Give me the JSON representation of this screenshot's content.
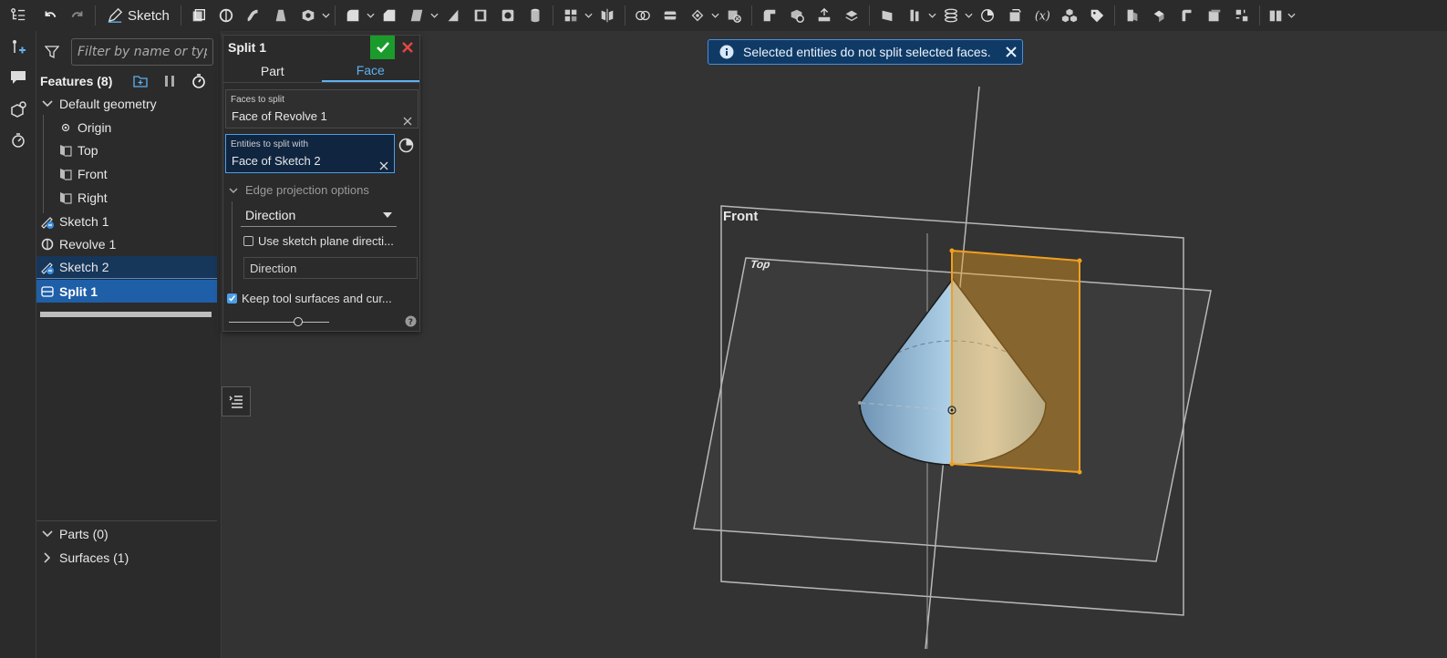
{
  "toolbar": {
    "sketch_label": "Sketch"
  },
  "feature_panel": {
    "filter_placeholder": "Filter by name or type",
    "features_title": "Features (8)",
    "tree": [
      {
        "label": "Default geometry"
      },
      {
        "label": "Origin"
      },
      {
        "label": "Top"
      },
      {
        "label": "Front"
      },
      {
        "label": "Right"
      },
      {
        "label": "Sketch 1"
      },
      {
        "label": "Revolve 1"
      },
      {
        "label": "Sketch 2"
      },
      {
        "label": "Split 1"
      }
    ],
    "parts_label": "Parts (0)",
    "surfaces_label": "Surfaces (1)"
  },
  "split_dialog": {
    "title": "Split 1",
    "tabs": [
      {
        "label": "Part"
      },
      {
        "label": "Face"
      }
    ],
    "active_tab": "Face",
    "faces_to_split": {
      "label": "Faces to split",
      "value": "Face of Revolve 1"
    },
    "entities_to_split_with": {
      "label": "Entities to split with",
      "value": "Face of Sketch 2"
    },
    "edge_projection_label": "Edge projection options",
    "direction_select": "Direction",
    "use_sketch_plane_label": "Use sketch plane directi...",
    "direction_field": "Direction",
    "keep_tool_surfaces_label": "Keep tool surfaces and cur..."
  },
  "toast": {
    "message": "Selected entities do not split selected faces."
  },
  "viewport": {
    "front_plane_label": "Front",
    "top_plane_label": "Top",
    "cone_color": "#a9cbe3",
    "highlight_color": "#f0a020"
  }
}
